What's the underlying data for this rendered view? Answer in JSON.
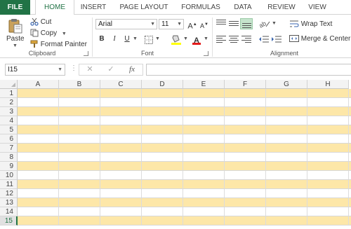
{
  "tabs": [
    {
      "label": "FILE",
      "id": "file"
    },
    {
      "label": "HOME",
      "id": "home"
    },
    {
      "label": "INSERT",
      "id": "insert"
    },
    {
      "label": "PAGE LAYOUT",
      "id": "page-layout"
    },
    {
      "label": "FORMULAS",
      "id": "formulas"
    },
    {
      "label": "DATA",
      "id": "data"
    },
    {
      "label": "REVIEW",
      "id": "review"
    },
    {
      "label": "VIEW",
      "id": "view"
    }
  ],
  "active_tab": "HOME",
  "clipboard": {
    "paste_label": "Paste",
    "cut_label": "Cut",
    "copy_label": "Copy",
    "format_painter_label": "Format Painter",
    "group_label": "Clipboard"
  },
  "font": {
    "name": "Arial",
    "size": "11",
    "grow_label": "A",
    "shrink_label": "A",
    "bold_label": "B",
    "italic_label": "I",
    "underline_label": "U",
    "font_color_label": "A",
    "group_label": "Font",
    "font_color": "#e31b1b",
    "highlight_color": "#ffff00"
  },
  "alignment": {
    "wrap_text_label": "Wrap Text",
    "merge_center_label": "Merge & Center",
    "group_label": "Alignment"
  },
  "formula_bar": {
    "name_box": "I15",
    "dots": "⋮",
    "cancel": "✕",
    "enter": "✓",
    "fx": "fx",
    "value": ""
  },
  "columns": [
    "A",
    "B",
    "C",
    "D",
    "E",
    "F",
    "G",
    "H"
  ],
  "rows": [
    "1",
    "2",
    "3",
    "4",
    "5",
    "6",
    "7",
    "8",
    "9",
    "10",
    "11",
    "12",
    "13",
    "14",
    "15"
  ],
  "selected_row": "15",
  "colors": {
    "accent": "#217346",
    "band": "#fde7a8",
    "plain": "#ffffff"
  }
}
